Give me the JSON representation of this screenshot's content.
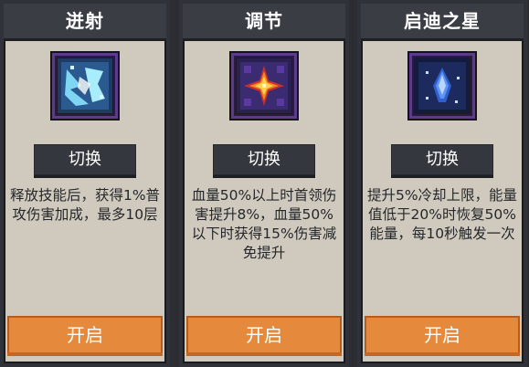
{
  "cards": [
    {
      "title": "迸射",
      "switch_label": "切换",
      "description": "释放技能后，获得1%普攻伤害加成，最多10层",
      "open_label": "开启",
      "icon": "shatter-icon"
    },
    {
      "title": "调节",
      "switch_label": "切换",
      "description": "血量50%以上时首领伤害提升8%，血量50%以下时获得15%伤害减免提升",
      "open_label": "开启",
      "icon": "sunburst-icon"
    },
    {
      "title": "启迪之星",
      "switch_label": "切换",
      "description": "提升5%冷却上限，能量值低于20%时恢复50%能量，每10秒触发一次",
      "open_label": "开启",
      "icon": "star-crystal-icon"
    }
  ],
  "colors": {
    "card_bg": "#cfcabd",
    "title_bg": "#3a3d43",
    "switch_bg": "#34383e",
    "open_bg": "#e58a3d",
    "frame_purple": "#5b3b8a"
  }
}
